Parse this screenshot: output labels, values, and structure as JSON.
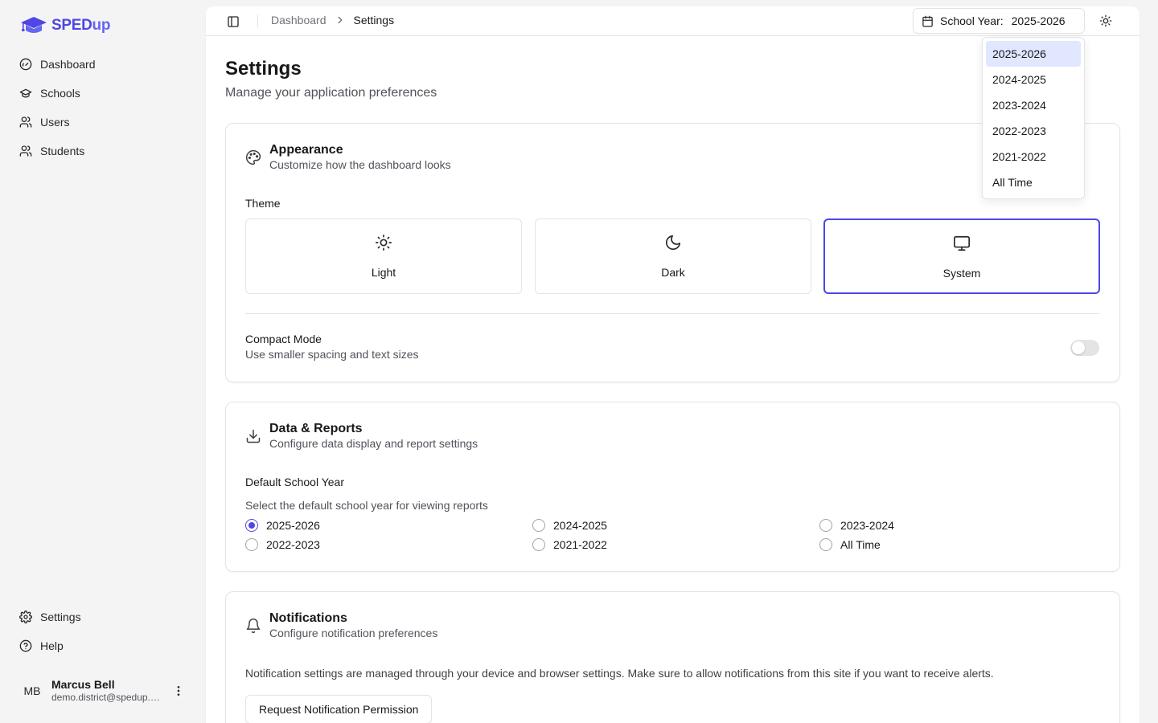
{
  "brand": {
    "name_main": "SPED",
    "name_accent": "up"
  },
  "sidebar": {
    "nav": [
      {
        "label": "Dashboard",
        "icon": "gauge-icon"
      },
      {
        "label": "Schools",
        "icon": "graduation-cap-icon"
      },
      {
        "label": "Users",
        "icon": "users-icon"
      },
      {
        "label": "Students",
        "icon": "users-icon"
      }
    ],
    "bottom_nav": [
      {
        "label": "Settings",
        "icon": "gear-icon"
      },
      {
        "label": "Help",
        "icon": "help-circle-icon"
      }
    ],
    "user": {
      "initials": "MB",
      "name": "Marcus Bell",
      "email": "demo.district@spedup.com"
    }
  },
  "topbar": {
    "breadcrumb": [
      "Dashboard",
      "Settings"
    ],
    "school_year_label": "School Year:",
    "school_year_value": "2025-2026"
  },
  "year_dropdown": {
    "options": [
      "2025-2026",
      "2024-2025",
      "2023-2024",
      "2022-2023",
      "2021-2022",
      "All Time"
    ],
    "active": "2025-2026"
  },
  "page": {
    "title": "Settings",
    "subtitle": "Manage your application preferences"
  },
  "appearance": {
    "title": "Appearance",
    "description": "Customize how the dashboard looks",
    "theme_label": "Theme",
    "themes": [
      {
        "label": "Light",
        "icon": "sun-icon"
      },
      {
        "label": "Dark",
        "icon": "moon-icon"
      },
      {
        "label": "System",
        "icon": "monitor-icon"
      }
    ],
    "selected_theme": "System",
    "compact_title": "Compact Mode",
    "compact_description": "Use smaller spacing and text sizes",
    "compact_enabled": false
  },
  "data_reports": {
    "title": "Data & Reports",
    "description": "Configure data display and report settings",
    "default_year_label": "Default School Year",
    "default_year_help": "Select the default school year for viewing reports",
    "years": [
      "2025-2026",
      "2024-2025",
      "2023-2024",
      "2022-2023",
      "2021-2022",
      "All Time"
    ],
    "selected_year": "2025-2026"
  },
  "notifications": {
    "title": "Notifications",
    "description": "Configure notification preferences",
    "info": "Notification settings are managed through your device and browser settings. Make sure to allow notifications from this site if you want to receive alerts.",
    "button_label": "Request Notification Permission"
  },
  "colors": {
    "accent": "#4f46e5",
    "dropdown_highlight": "#e0e7ff",
    "background": "#f4f4f5"
  }
}
